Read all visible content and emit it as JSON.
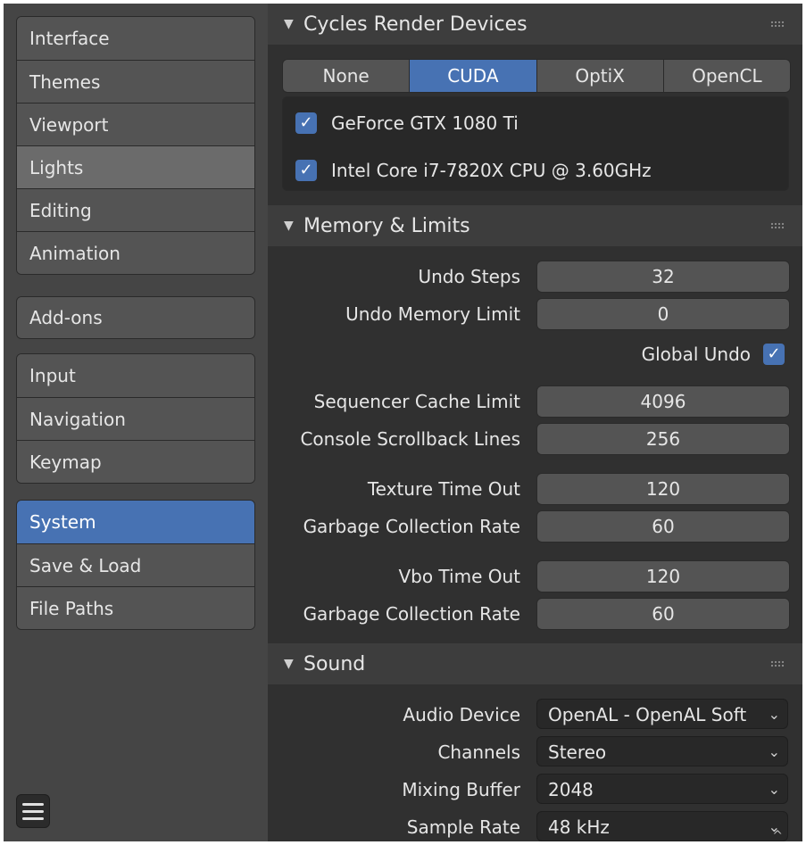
{
  "sidebar": {
    "groups": [
      [
        "Interface",
        "Themes",
        "Viewport",
        "Lights",
        "Editing",
        "Animation"
      ],
      [
        "Add-ons"
      ],
      [
        "Input",
        "Navigation",
        "Keymap"
      ],
      [
        "System",
        "Save & Load",
        "File Paths"
      ]
    ],
    "active": "System",
    "hovered": "Lights"
  },
  "panels": {
    "cycles": {
      "title": "Cycles Render Devices",
      "tabs": [
        "None",
        "CUDA",
        "OptiX",
        "OpenCL"
      ],
      "selected_tab": "CUDA",
      "devices": [
        {
          "name": "GeForce GTX 1080 Ti",
          "checked": true
        },
        {
          "name": "Intel Core i7-7820X CPU @ 3.60GHz",
          "checked": true
        }
      ]
    },
    "memory": {
      "title": "Memory & Limits",
      "undo_steps_label": "Undo Steps",
      "undo_steps_value": "32",
      "undo_memory_label": "Undo Memory Limit",
      "undo_memory_value": "0",
      "global_undo_label": "Global Undo",
      "global_undo_checked": true,
      "seq_cache_label": "Sequencer Cache Limit",
      "seq_cache_value": "4096",
      "console_label": "Console Scrollback Lines",
      "console_value": "256",
      "texture_timeout_label": "Texture Time Out",
      "texture_timeout_value": "120",
      "gc_rate_label_1": "Garbage Collection Rate",
      "gc_rate_value_1": "60",
      "vbo_timeout_label": "Vbo Time Out",
      "vbo_timeout_value": "120",
      "gc_rate_label_2": "Garbage Collection Rate",
      "gc_rate_value_2": "60"
    },
    "sound": {
      "title": "Sound",
      "audio_device_label": "Audio Device",
      "audio_device_value": "OpenAL - OpenAL Soft",
      "channels_label": "Channels",
      "channels_value": "Stereo",
      "mixing_buffer_label": "Mixing Buffer",
      "mixing_buffer_value": "2048",
      "sample_rate_label": "Sample Rate",
      "sample_rate_value": "48 kHz"
    }
  },
  "icons": {
    "collapse": "▼",
    "check": "✓",
    "chevron": "⌄",
    "scroll_up": "^"
  },
  "colors": {
    "accent": "#4772b3",
    "panel_bg": "#303030",
    "sidebar_bg": "#454545"
  }
}
